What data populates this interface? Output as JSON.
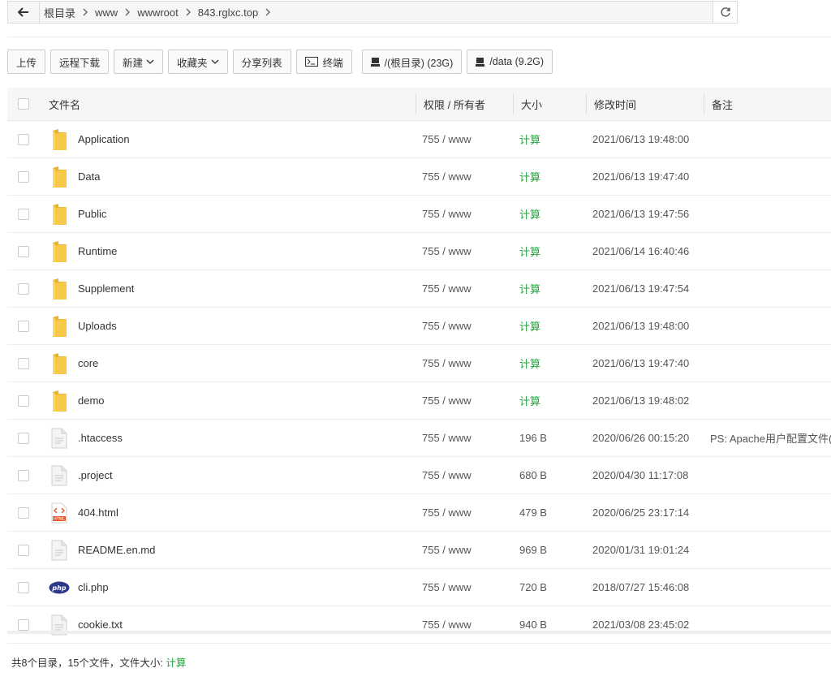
{
  "address": {
    "crumbs": [
      "根目录",
      "www",
      "wwwroot",
      "843.rglxc.top"
    ]
  },
  "toolbar": {
    "upload": "上传",
    "remote_download": "远程下载",
    "new": "新建",
    "favorites": "收藏夹",
    "share_list": "分享列表",
    "terminal": "终端",
    "disks": [
      {
        "label": "/(根目录) (23G)"
      },
      {
        "label": "/data (9.2G)"
      }
    ]
  },
  "table": {
    "headers": {
      "name": "文件名",
      "perm": "权限 / 所有者",
      "size": "大小",
      "mtime": "修改时间",
      "note": "备注"
    },
    "rows": [
      {
        "name": "Application",
        "icon": "folder-icon",
        "perm": "755 / www",
        "size": "计算",
        "mtime": "2021/06/13 19:48:00",
        "note": ""
      },
      {
        "name": "Data",
        "icon": "folder-icon",
        "perm": "755 / www",
        "size": "计算",
        "mtime": "2021/06/13 19:47:40",
        "note": ""
      },
      {
        "name": "Public",
        "icon": "folder-icon",
        "perm": "755 / www",
        "size": "计算",
        "mtime": "2021/06/13 19:47:56",
        "note": ""
      },
      {
        "name": "Runtime",
        "icon": "folder-icon",
        "perm": "755 / www",
        "size": "计算",
        "mtime": "2021/06/14 16:40:46",
        "note": ""
      },
      {
        "name": "Supplement",
        "icon": "folder-icon",
        "perm": "755 / www",
        "size": "计算",
        "mtime": "2021/06/13 19:47:54",
        "note": ""
      },
      {
        "name": "Uploads",
        "icon": "folder-icon",
        "perm": "755 / www",
        "size": "计算",
        "mtime": "2021/06/13 19:48:00",
        "note": ""
      },
      {
        "name": "core",
        "icon": "folder-icon",
        "perm": "755 / www",
        "size": "计算",
        "mtime": "2021/06/13 19:47:40",
        "note": ""
      },
      {
        "name": "demo",
        "icon": "folder-icon",
        "perm": "755 / www",
        "size": "计算",
        "mtime": "2021/06/13 19:48:02",
        "note": ""
      },
      {
        "name": ".htaccess",
        "icon": "file-icon",
        "perm": "755 / www",
        "size": "196 B",
        "mtime": "2020/06/26 00:15:20",
        "note": "PS: Apache用户配置文件(伪"
      },
      {
        "name": ".project",
        "icon": "file-icon",
        "perm": "755 / www",
        "size": "680 B",
        "mtime": "2020/04/30 11:17:08",
        "note": ""
      },
      {
        "name": "404.html",
        "icon": "html-file-icon",
        "perm": "755 / www",
        "size": "479 B",
        "mtime": "2020/06/25 23:17:14",
        "note": ""
      },
      {
        "name": "README.en.md",
        "icon": "file-icon",
        "perm": "755 / www",
        "size": "969 B",
        "mtime": "2020/01/31 19:01:24",
        "note": ""
      },
      {
        "name": "cli.php",
        "icon": "php-file-icon",
        "perm": "755 / www",
        "size": "720 B",
        "mtime": "2018/07/27 15:46:08",
        "note": ""
      },
      {
        "name": "cookie.txt",
        "icon": "file-icon",
        "perm": "755 / www",
        "size": "940 B",
        "mtime": "2021/03/08 23:45:02",
        "note": ""
      }
    ]
  },
  "footer": {
    "summary": "共8个目录，15个文件，文件大小:",
    "calc": "计算"
  },
  "colors": {
    "accent_green": "#20a53a",
    "folder_yellow": "#f7c948"
  }
}
